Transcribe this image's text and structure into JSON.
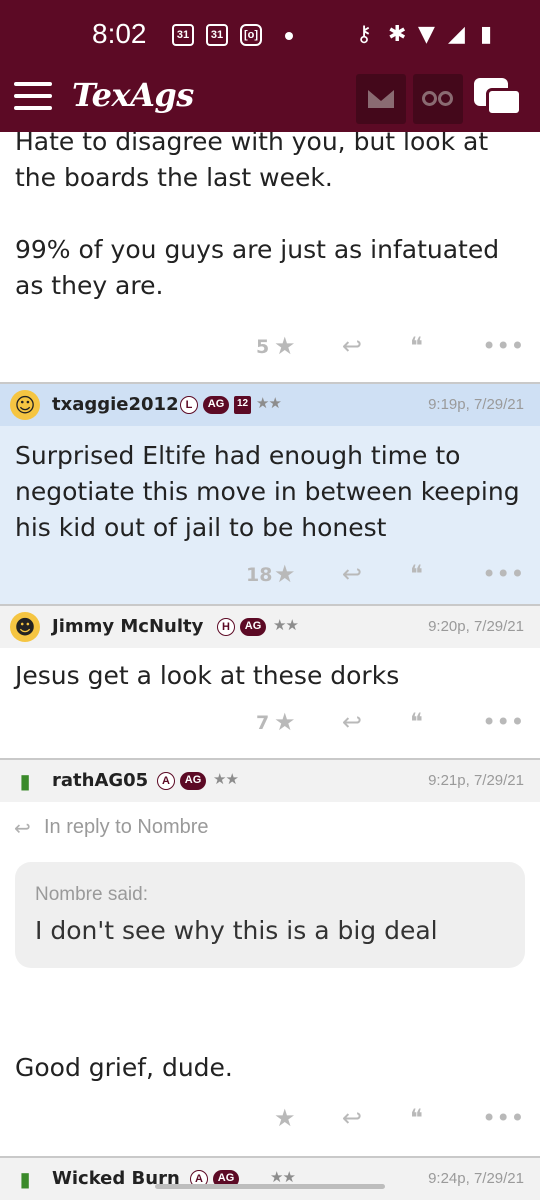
{
  "status_bar": {
    "time": "8:02",
    "cal1": "31",
    "cal2": "31",
    "record": "[o]"
  },
  "app": {
    "logo": "TexAgs"
  },
  "posts": [
    {
      "body_lines": [
        "Hate to disagree with you, but look at",
        "the boards the last week."
      ],
      "body_lines_2": [
        "99% of you guys are just as infatuated",
        "as they are."
      ],
      "likes": "5"
    },
    {
      "username": "txaggie2012",
      "badges": [
        "L",
        "AG",
        "12"
      ],
      "stars": "★★",
      "time": "9:19p, 7/29/21",
      "body": "Surprised Eltife had enough time to negotiate this move in between keeping his kid out of jail to be honest",
      "likes": "18"
    },
    {
      "username": "Jimmy McNulty",
      "badges": [
        "H",
        "AG"
      ],
      "stars": "★★",
      "time": "9:20p, 7/29/21",
      "body": "Jesus get a look at these dorks",
      "likes": "7"
    },
    {
      "username": "rathAG05",
      "badges": [
        "A",
        "AG"
      ],
      "stars": "★★",
      "time": "9:21p, 7/29/21",
      "reply_to": "In reply to Nombre",
      "quote_author": "Nombre said:",
      "quote_text": "I don't see why this is a big deal",
      "body": "Good grief, dude.",
      "likes": ""
    },
    {
      "username": "Wicked Burn",
      "badges": [
        "A",
        "AG"
      ],
      "stars": "★★",
      "time": "9:24p, 7/29/21"
    }
  ],
  "icons": {
    "star": "★",
    "reply": "↩",
    "quote": "❝",
    "more": "•••"
  },
  "colors": {
    "brand": "#5c0a25",
    "highlight": "#cfe0f4"
  }
}
